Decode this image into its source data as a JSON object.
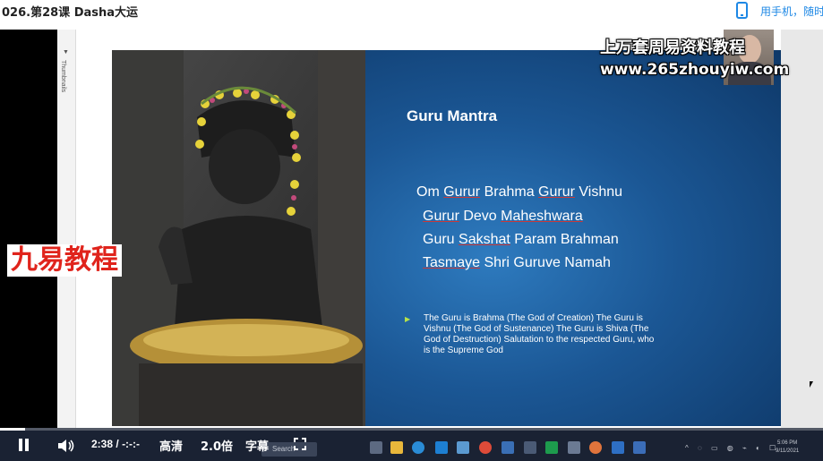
{
  "page": {
    "title": "026.第28课 Dasha大运",
    "mobile_link": "用手机，随时",
    "mobile_icon": "phone-icon"
  },
  "ppt": {
    "thumbnails_label": "Thumbnails",
    "slide": {
      "title": "Guru Mantra",
      "mantra_lines": [
        [
          "Om ",
          "Gurur",
          " Brahma ",
          "Gurur",
          " Vishnu"
        ],
        [
          "Gurur",
          " Devo ",
          "Maheshwara"
        ],
        [
          "Guru ",
          "Sakshat",
          " Param Brahman"
        ],
        [
          "Tasmaye",
          " Shri Guruve Namah"
        ]
      ],
      "bullet": "The Guru is Brahma (The God of Creation) The Guru is Vishnu (The God of Sustenance) The Guru is Shiva (The God of Destruction) Salutation to the respected Guru, who is the Supreme God"
    }
  },
  "overlay": {
    "watermark_line1": "上万套周易资料教程",
    "watermark_line2": "www.265zhouyiw.com",
    "logo": "九易教程"
  },
  "player": {
    "progress_fraction": 0.03,
    "time_current": "2:38",
    "time_separator": "/",
    "time_total": "-:-:-",
    "quality": "高清",
    "speed": "2.0倍",
    "subtitles": "字幕",
    "icons": [
      "pause-icon",
      "volume-icon",
      "fullscreen-icon"
    ]
  },
  "windows_taskbar": {
    "search_placeholder": "Search",
    "time": "5:06 PM",
    "date": "9/11/2021"
  },
  "colors": {
    "slide_blue": "#1b5795",
    "accent_green": "#8cc63f",
    "link_blue": "#1e88e5",
    "logo_red": "#e0241c"
  }
}
